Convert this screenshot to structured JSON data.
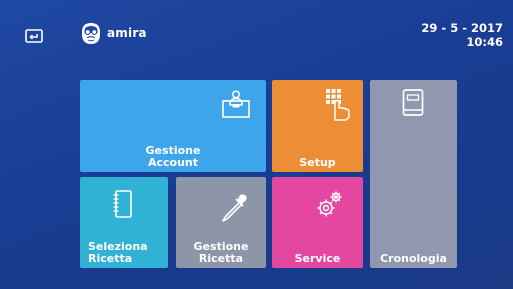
{
  "header": {
    "back_icon": "back-arrow-icon",
    "avatar_icon": "bearded-user-icon",
    "username": "amira",
    "date": "29 - 5 - 2017",
    "time": "10:46"
  },
  "tiles": {
    "account": {
      "label_line1": "Gestione",
      "label_line2": "Account",
      "icon": "id-card-user-icon",
      "color": "#3fa5ea"
    },
    "setup": {
      "label": "Setup",
      "icon": "keypad-hand-icon",
      "color": "#ed8d35"
    },
    "cronologia": {
      "label": "Cronologia",
      "icon": "book-icon",
      "color": "#8f98ae"
    },
    "seleziona_ricetta": {
      "label_line1": "Seleziona",
      "label_line2": "Ricetta",
      "icon": "notebook-icon",
      "color": "#30b2d4"
    },
    "gestione_ricetta": {
      "label_line1": "Gestione",
      "label_line2": "Ricetta",
      "icon": "dropper-icon",
      "color": "#8d95a8"
    },
    "service": {
      "label": "Service",
      "icon": "gears-icon",
      "color": "#e3479f"
    }
  }
}
